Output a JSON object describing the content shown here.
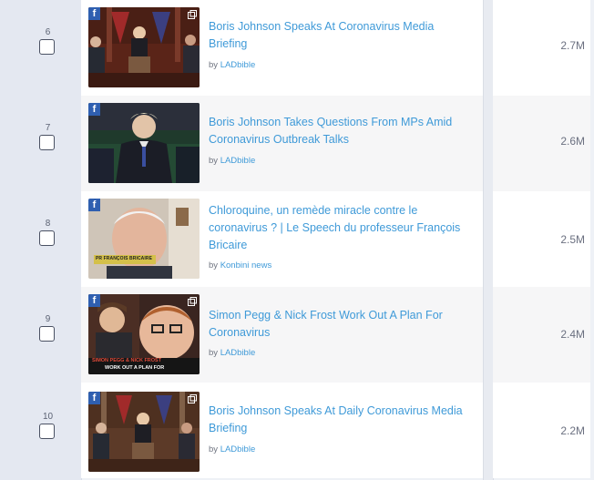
{
  "rows": [
    {
      "rank": "6",
      "title": "Boris Johnson Speaks At Coronavirus Media Briefing",
      "by": "by",
      "source": "LADbible",
      "views": "2.7M",
      "platform": "facebook"
    },
    {
      "rank": "7",
      "title": "Boris Johnson Takes Questions From MPs Amid Coronavirus Outbreak Talks",
      "by": "by",
      "source": "LADbible",
      "views": "2.6M",
      "platform": "facebook"
    },
    {
      "rank": "8",
      "title": "Chloroquine, un remède miracle contre le coronavirus ? | Le Speech du professeur François Bricaire",
      "by": "by",
      "source": "Konbini news",
      "views": "2.5M",
      "platform": "facebook"
    },
    {
      "rank": "9",
      "title": "Simon Pegg & Nick Frost Work Out A Plan For Coronavirus",
      "by": "by",
      "source": "LADbible",
      "views": "2.4M",
      "platform": "facebook"
    },
    {
      "rank": "10",
      "title": "Boris Johnson Speaks At Daily Coronavirus Media Briefing",
      "by": "by",
      "source": "LADbible",
      "views": "2.2M",
      "platform": "facebook"
    }
  ],
  "thumbnail_captions": {
    "row8": "PR FRANÇOIS BRICAIRE",
    "row9_line1": "SIMON PEGG & NICK FROST",
    "row9_line2": "WORK OUT A PLAN FOR"
  },
  "icons": {
    "platform": "facebook-icon",
    "external": "external-link-icon"
  },
  "colors": {
    "link": "#3f9ad8",
    "facebook": "#2f5fb0",
    "rail": "#e4e8f1"
  }
}
